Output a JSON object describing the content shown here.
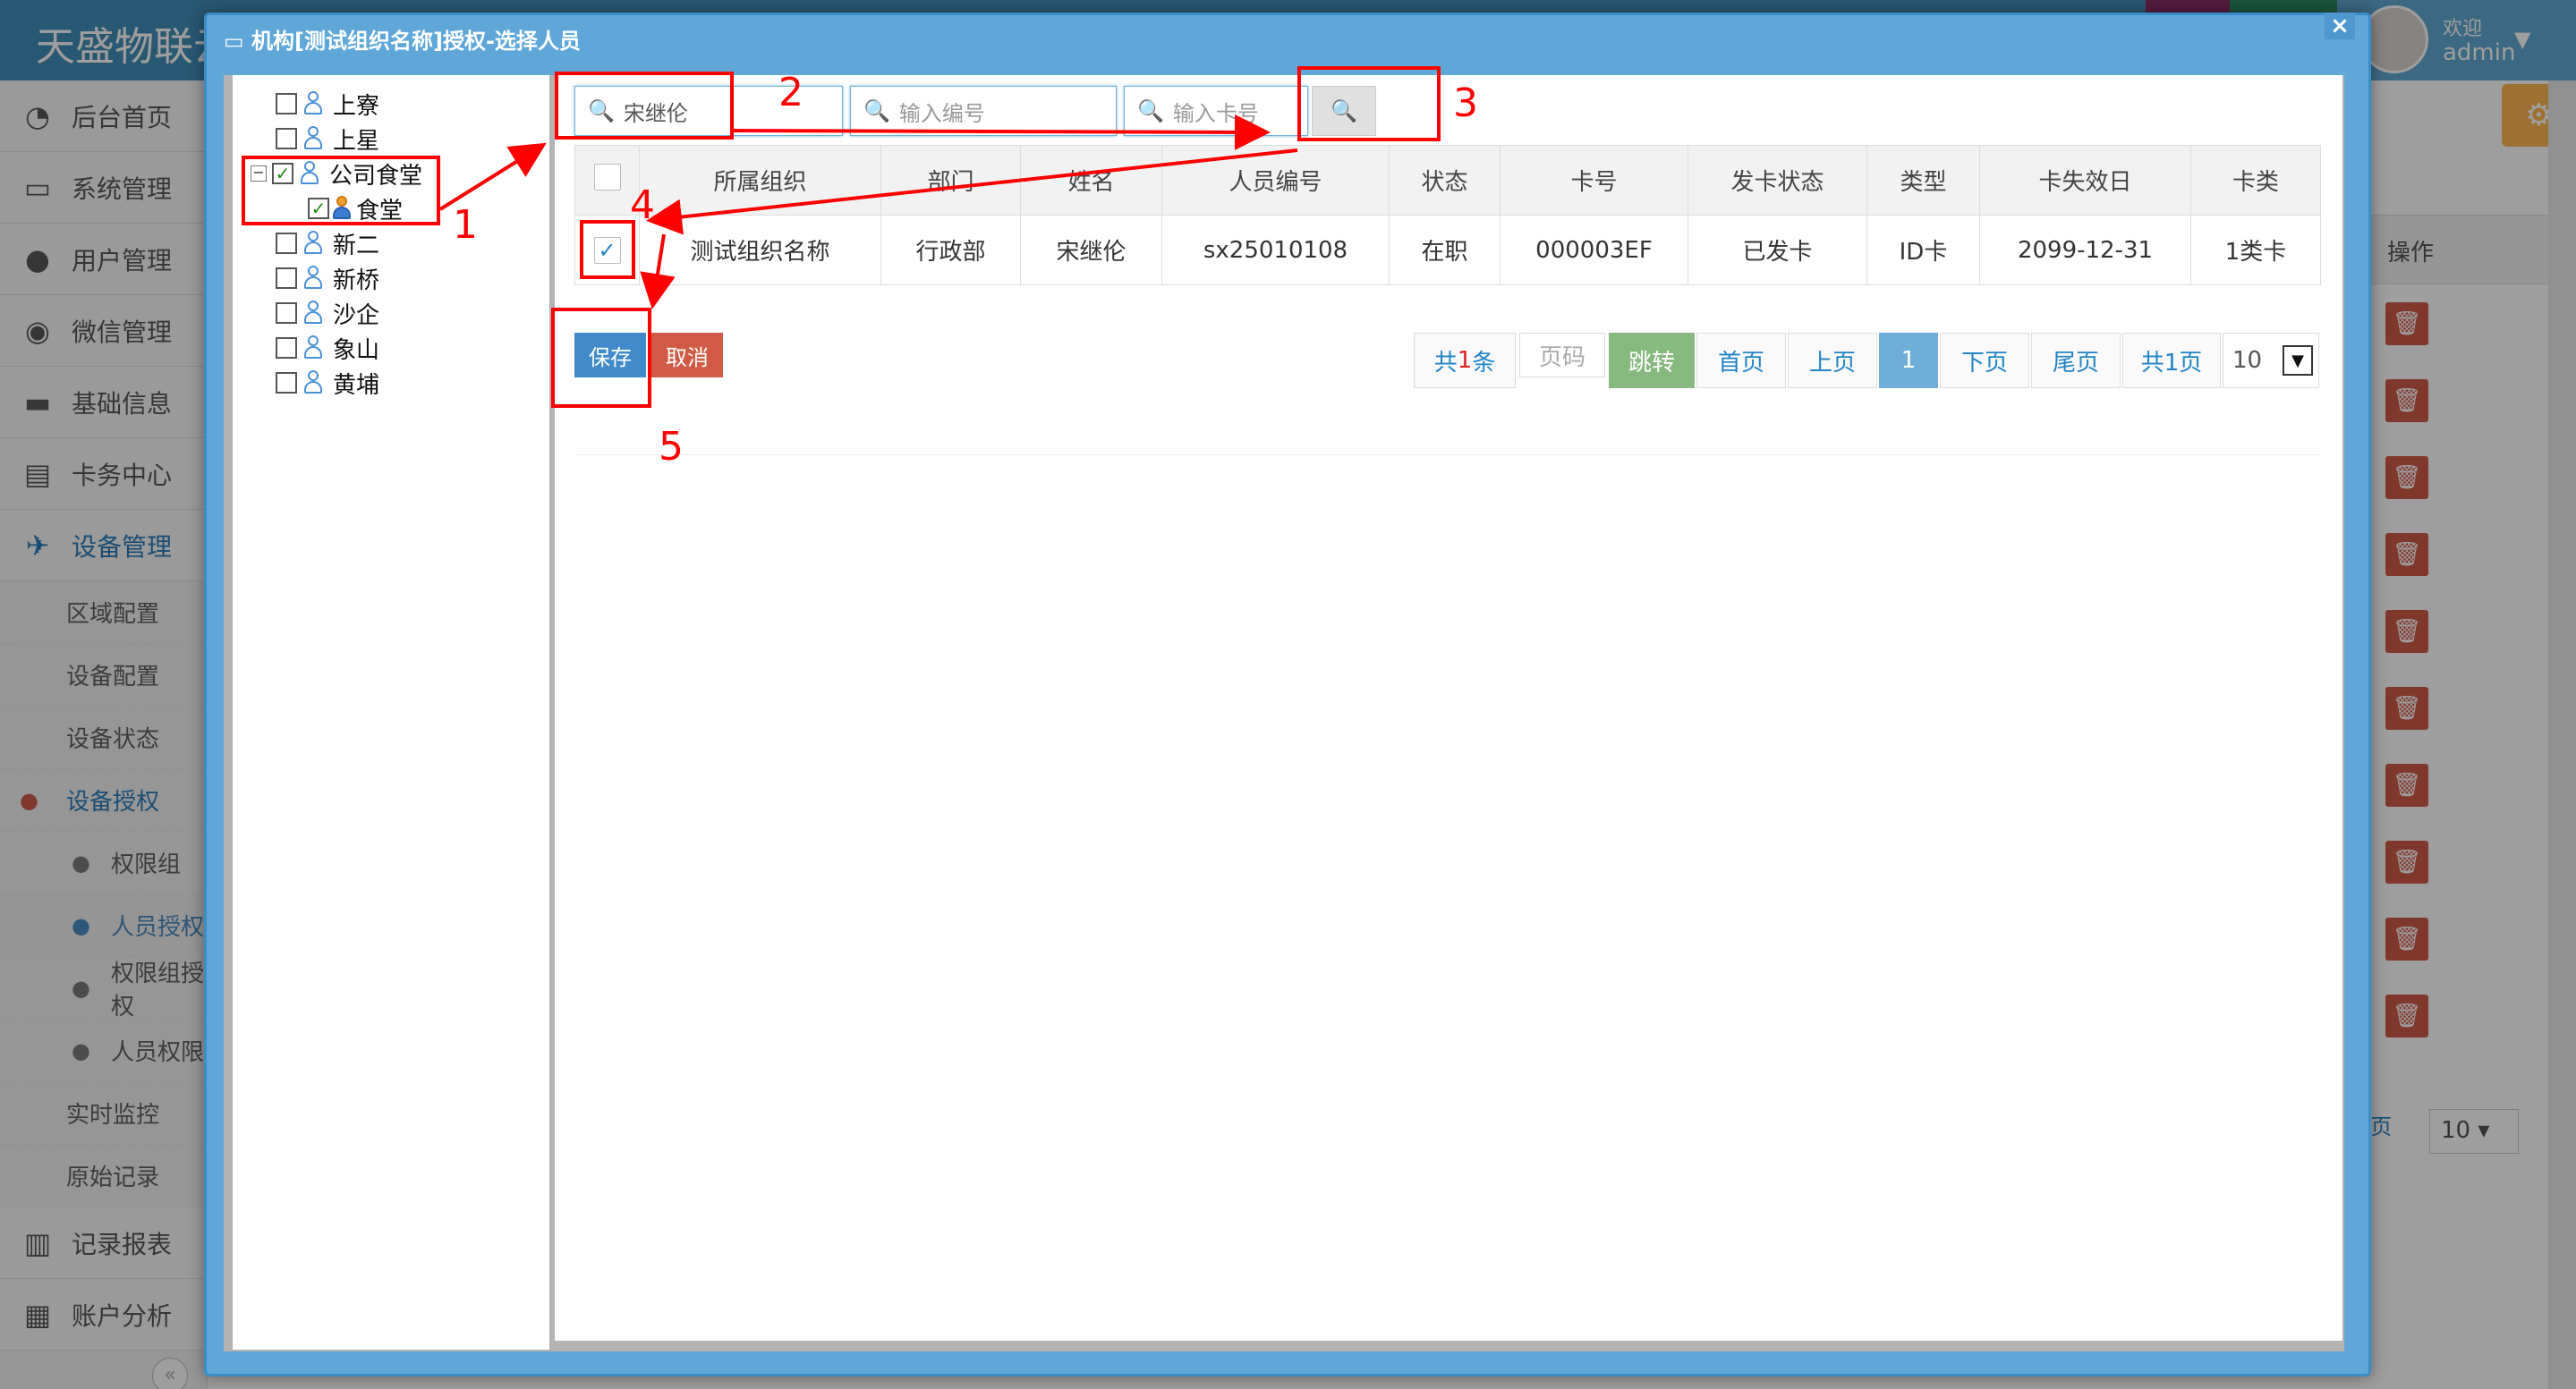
{
  "app": {
    "brand": "天盛物联云"
  },
  "navbar": {
    "welcome": "欢迎",
    "user": "admin"
  },
  "sidebar": {
    "items": [
      {
        "label": "后台首页",
        "icon": "tachometer-icon"
      },
      {
        "label": "系统管理",
        "icon": "desktop-icon"
      },
      {
        "label": "用户管理",
        "icon": "users-icon"
      },
      {
        "label": "微信管理",
        "icon": "comments-icon"
      },
      {
        "label": "基础信息",
        "icon": "laptop-icon"
      },
      {
        "label": "卡务中心",
        "icon": "credit-card-icon"
      },
      {
        "label": "设备管理",
        "icon": "plane-icon"
      }
    ],
    "sub": [
      "区域配置",
      "设备配置",
      "设备状态",
      "设备授权",
      "权限组",
      "人员授权",
      "权限组授权",
      "人员权限",
      "实时监控",
      "原始记录"
    ],
    "bottom": [
      "记录报表",
      "账户分析"
    ]
  },
  "background": {
    "op_header": "操作",
    "pager_total": "共9页",
    "page_size": "10"
  },
  "dialog": {
    "title": "机构[测试组织名称]授权-选择人员",
    "close": "×"
  },
  "tree": [
    {
      "label": "上寮",
      "checked": false
    },
    {
      "label": "上星",
      "checked": false
    },
    {
      "label": "公司食堂",
      "checked": true
    },
    {
      "label": "食堂",
      "checked": true
    },
    {
      "label": "新二",
      "checked": false
    },
    {
      "label": "新桥",
      "checked": false
    },
    {
      "label": "沙企",
      "checked": false
    },
    {
      "label": "象山",
      "checked": false
    },
    {
      "label": "黄埔",
      "checked": false
    }
  ],
  "search": {
    "name_value": "宋继伦",
    "number_placeholder": "输入编号",
    "card_placeholder": "输入卡号"
  },
  "table": {
    "headers": [
      "所属组织",
      "部门",
      "姓名",
      "人员编号",
      "状态",
      "卡号",
      "发卡状态",
      "类型",
      "卡失效日",
      "卡类"
    ],
    "rows": [
      [
        "测试组织名称",
        "行政部",
        "宋继伦",
        "sx25010108",
        "在职",
        "000003EF",
        "已发卡",
        "ID卡",
        "2099-12-31",
        "1类卡"
      ]
    ]
  },
  "actions": {
    "save": "保存",
    "cancel": "取消"
  },
  "pager": {
    "total_prefix": "共",
    "total_count": "1",
    "total_suffix": "条",
    "page_input_placeholder": "页码",
    "jump": "跳转",
    "first": "首页",
    "prev": "上页",
    "current": "1",
    "next": "下页",
    "last": "尾页",
    "pages": "共1页",
    "size": "10"
  },
  "annotations": [
    "1",
    "2",
    "3",
    "4",
    "5"
  ],
  "colors": {
    "accent": "#438eb9",
    "save": "#428bca",
    "cancel": "#d15b47",
    "jump": "#87b87f",
    "annotation": "#ff0000"
  }
}
